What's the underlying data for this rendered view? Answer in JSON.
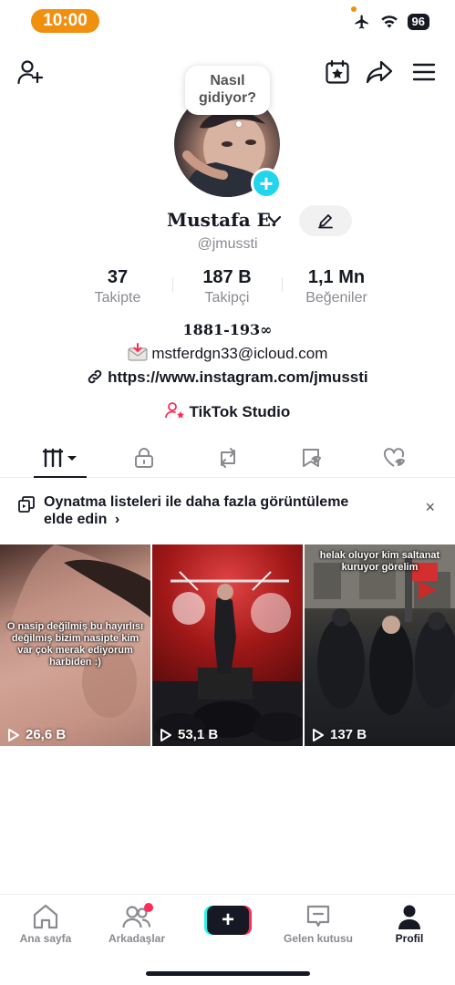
{
  "status_bar": {
    "time": "10:00",
    "battery": "96"
  },
  "profile": {
    "bubble_text": "Nasıl gidiyor?",
    "name": "Mustafa E.",
    "handle": "@jmussti"
  },
  "stats": [
    {
      "value": "37",
      "label": "Takipte"
    },
    {
      "value": "187 B",
      "label": "Takipçi"
    },
    {
      "value": "1,1 Mn",
      "label": "Beğeniler"
    }
  ],
  "bio": {
    "line1": "1881-193∞",
    "email": "mstferdgn33@icloud.com",
    "link": "https://www.instagram.com/jmussti",
    "studio": "TikTok Studio"
  },
  "banner": {
    "text": "Oynatma listeleri ile daha fazla görüntüleme elde edin",
    "chevron": "›",
    "close": "×"
  },
  "videos": [
    {
      "caption": "O nasip değilmiş bu hayırlısı değilmiş bizim nasipte kim var çok merak ediyorum harbiden :)",
      "views": "26,6 B"
    },
    {
      "caption": "",
      "views": "53,1 B"
    },
    {
      "caption": "helak oluyor kim saltanat kuruyor görelim",
      "views": "137 B"
    }
  ],
  "bottom_nav": [
    {
      "label": "Ana sayfa",
      "icon": "home-icon"
    },
    {
      "label": "Arkadaşlar",
      "icon": "friends-icon"
    },
    {
      "label": "",
      "icon": "create-icon"
    },
    {
      "label": "Gelen kutusu",
      "icon": "inbox-icon"
    },
    {
      "label": "Profil",
      "icon": "profile-icon"
    }
  ],
  "colors": {
    "accent_cyan": "#20d5ec",
    "brand_red": "#fe2c55",
    "time_pill": "#f0900e",
    "text_primary": "#161823",
    "text_secondary": "#8a8b91"
  }
}
